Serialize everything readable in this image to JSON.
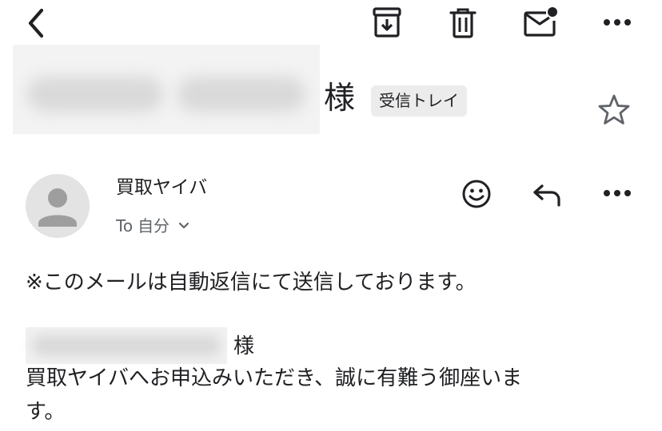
{
  "toolbar": {
    "back_icon": "chevron-left-icon",
    "archive_icon": "archive-icon",
    "delete_icon": "trash-icon",
    "mark_unread_icon": "mail-unread-icon",
    "more_icon": "more-horizontal-icon"
  },
  "subject": {
    "suffix": "様",
    "label": "受信トレイ",
    "star_icon": "star-outline-icon"
  },
  "message": {
    "sender_name": "買取ヤイバ",
    "recipient_prefix": "To",
    "recipient": "自分",
    "expand_icon": "chevron-down-icon",
    "actions": {
      "emoji_icon": "emoji-icon",
      "reply_icon": "reply-icon",
      "more_icon": "more-horizontal-icon"
    },
    "body": {
      "line1": "※このメールは自動返信にて送信しております。",
      "salutation_suffix": "様",
      "line3": "買取ヤイバへお申込みいただき、誠に有難う御座いま",
      "line4": "す。"
    }
  },
  "colors": {
    "icon": "#5f6368",
    "text": "#202124",
    "chip_bg": "#ececec",
    "avatar_bg": "#e3e3e3"
  }
}
